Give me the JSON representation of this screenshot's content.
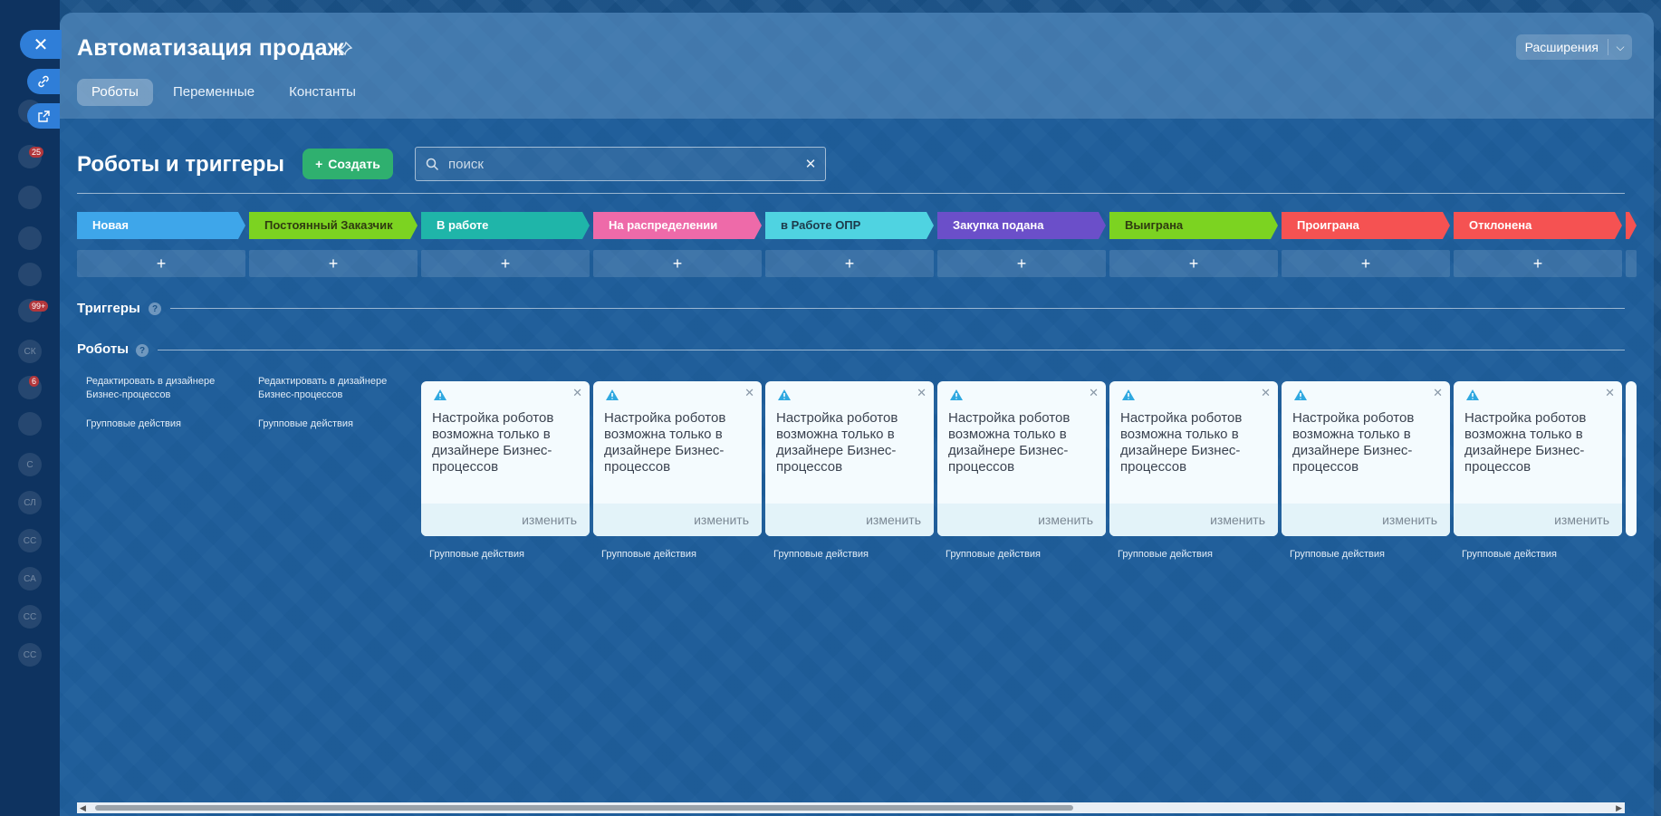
{
  "header": {
    "title": "Автоматизация продаж",
    "extensions_label": "Расширения",
    "tabs": [
      {
        "label": "Роботы",
        "active": true
      },
      {
        "label": "Переменные",
        "active": false
      },
      {
        "label": "Константы",
        "active": false
      }
    ]
  },
  "toolbar": {
    "section_title": "Роботы и триггеры",
    "create_label": "Создать",
    "search_placeholder": "поиск"
  },
  "stages": [
    {
      "name": "Новая",
      "color": "#3ea6ea",
      "text_color": "#ffffff"
    },
    {
      "name": "Постоянный Заказчик",
      "color": "#7cd321",
      "text_color": "#2f3b10"
    },
    {
      "name": "В работе",
      "color": "#1fb5a9",
      "text_color": "#ffffff"
    },
    {
      "name": "На распределении",
      "color": "#ee6aa9",
      "text_color": "#ffffff"
    },
    {
      "name": "в Работе ОПР",
      "color": "#4fd3e1",
      "text_color": "#1d3a4a"
    },
    {
      "name": "Закупка подана",
      "color": "#6b4fc9",
      "text_color": "#ffffff"
    },
    {
      "name": "Выиграна",
      "color": "#7cd321",
      "text_color": "#2f3b10"
    },
    {
      "name": "Проиграна",
      "color": "#f55252",
      "text_color": "#ffffff"
    },
    {
      "name": "Отклонена",
      "color": "#f55252",
      "text_color": "#ffffff"
    }
  ],
  "add_symbol": "+",
  "triggers_title": "Триггеры",
  "robots_title": "Роботы",
  "help_symbol": "?",
  "designer_link": "Редактировать в дизайнере Бизнес-процессов",
  "group_actions": "Групповые действия",
  "robot_card": {
    "text": "Настройка роботов возможна только в дизайнере Бизнес-процессов",
    "edit_label": "изменить"
  },
  "sidebar_badges": [
    "25",
    "99+",
    "6"
  ],
  "sidebar_initials": [
    "СК",
    "С",
    "СЛ",
    "СС",
    "СА",
    "СС",
    "СС"
  ]
}
